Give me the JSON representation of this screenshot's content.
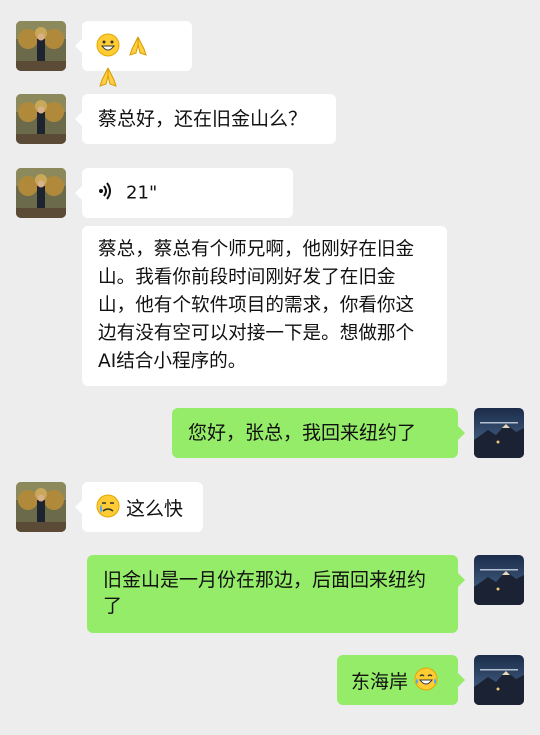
{
  "chat": {
    "messages": [
      {
        "side": "left",
        "type": "emoji",
        "emojis": [
          "grinning-face-icon",
          "folded-hands-icon",
          "folded-hands-icon"
        ]
      },
      {
        "side": "left",
        "type": "text",
        "text": "蔡总好，还在旧金山么？"
      },
      {
        "side": "left",
        "type": "voice",
        "duration": "21\""
      },
      {
        "side": "left",
        "type": "text",
        "text": "蔡总，蔡总有个师兄啊，他刚好在旧金山。我看你前段时间刚好发了在旧金山，他有个软件项目的需求，你看你这边有没有空可以对接一下是。想做那个AI结合小程序的。"
      },
      {
        "side": "right",
        "type": "text",
        "text": "您好，张总，我回来纽约了"
      },
      {
        "side": "left",
        "type": "text",
        "text": "这么快",
        "leading_emoji": "crying-face-icon"
      },
      {
        "side": "right",
        "type": "text",
        "text": "旧金山是一月份在那边，后面回来纽约了"
      },
      {
        "side": "right",
        "type": "text",
        "text": "东海岸",
        "trailing_emoji": "tears-of-joy-icon"
      }
    ]
  },
  "colors": {
    "background": "#ededed",
    "incoming_bubble": "#ffffff",
    "outgoing_bubble": "#95ec69"
  }
}
